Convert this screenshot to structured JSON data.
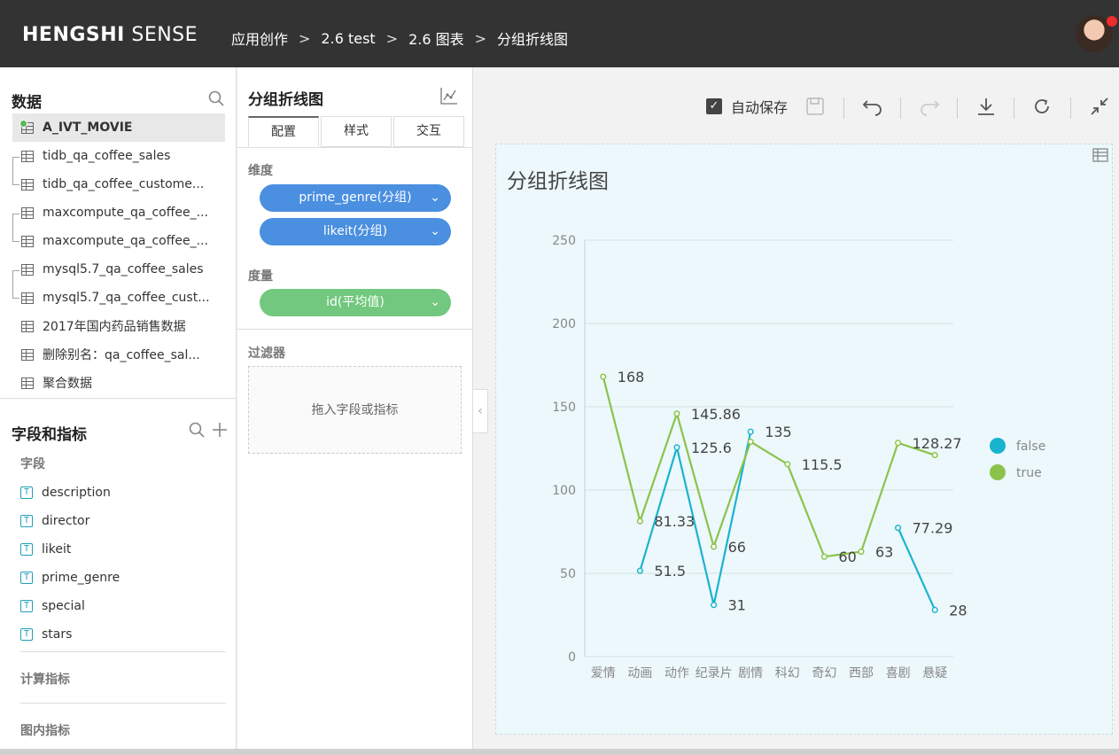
{
  "app": {
    "brand_bold": "HENGSHI",
    "brand_light": " SENSE"
  },
  "breadcrumb": [
    "应用创作",
    "2.6 test",
    "2.6 图表",
    "分组折线图"
  ],
  "breadcrumb_sep": ">",
  "data_panel": {
    "title": "数据",
    "sources": [
      {
        "label": "A_IVT_MOVIE",
        "active": true
      },
      {
        "label": "tidb_qa_coffee_sales"
      },
      {
        "label": "tidb_qa_coffee_custome..."
      },
      {
        "label": "maxcompute_qa_coffee_..."
      },
      {
        "label": "maxcompute_qa_coffee_..."
      },
      {
        "label": "mysql5.7_qa_coffee_sales"
      },
      {
        "label": "mysql5.7_qa_coffee_cust..."
      },
      {
        "label": "2017年国内药品销售数据"
      },
      {
        "label": "删除别名：qa_coffee_sal..."
      },
      {
        "label": "聚合数据"
      }
    ]
  },
  "fields_panel": {
    "title": "字段和指标",
    "fields_label": "字段",
    "fields": [
      "description",
      "director",
      "likeit",
      "prime_genre",
      "special",
      "stars"
    ],
    "field_type_glyph": "T",
    "calc_label": "计算指标",
    "inchart_label": "图内指标"
  },
  "config_panel": {
    "title": "分组折线图",
    "tabs": [
      "配置",
      "样式",
      "交互"
    ],
    "dimension_label": "维度",
    "dimensions": [
      "prime_genre(分组)",
      "likeit(分组)"
    ],
    "measure_label": "度量",
    "measures": [
      "id(平均值)"
    ],
    "filter_label": "过滤器",
    "filter_placeholder": "拖入字段或指标"
  },
  "toolbar": {
    "autosave_label": "自动保存",
    "autosave_checked": true
  },
  "colors": {
    "false": "#1ab3cf",
    "true": "#8bc34a",
    "pill_blue": "#4a8fe0",
    "pill_green": "#72c87e"
  },
  "chart_data": {
    "type": "line",
    "title": "分组折线图",
    "categories": [
      "爱情",
      "动画",
      "动作",
      "纪录片",
      "剧情",
      "科幻",
      "奇幻",
      "西部",
      "喜剧",
      "悬疑"
    ],
    "yticks": [
      "0",
      "50",
      "100",
      "150",
      "200",
      "250"
    ],
    "ylim": [
      0,
      250
    ],
    "legend_position": "right",
    "series": [
      {
        "name": "false",
        "values": [
          null,
          51.5,
          125.6,
          31,
          135,
          null,
          null,
          null,
          77.29,
          28
        ]
      },
      {
        "name": "true",
        "values": [
          168,
          81.33,
          145.86,
          66,
          129,
          115.5,
          60,
          63,
          128.27,
          121
        ]
      }
    ],
    "labels": [
      {
        "series": 1,
        "index": 0,
        "text": "168"
      },
      {
        "series": 0,
        "index": 1,
        "text": "51.5"
      },
      {
        "series": 1,
        "index": 1,
        "text": "81.33"
      },
      {
        "series": 0,
        "index": 2,
        "text": "125.6"
      },
      {
        "series": 1,
        "index": 2,
        "text": "145.86"
      },
      {
        "series": 0,
        "index": 3,
        "text": "31"
      },
      {
        "series": 1,
        "index": 3,
        "text": "66"
      },
      {
        "series": 0,
        "index": 4,
        "text": "135"
      },
      {
        "series": 1,
        "index": 5,
        "text": "115.5"
      },
      {
        "series": 1,
        "index": 6,
        "text": "60"
      },
      {
        "series": 1,
        "index": 7,
        "text": "63"
      },
      {
        "series": 0,
        "index": 8,
        "text": "77.29"
      },
      {
        "series": 1,
        "index": 8,
        "text": "128.27"
      },
      {
        "series": 0,
        "index": 9,
        "text": "28"
      }
    ]
  }
}
